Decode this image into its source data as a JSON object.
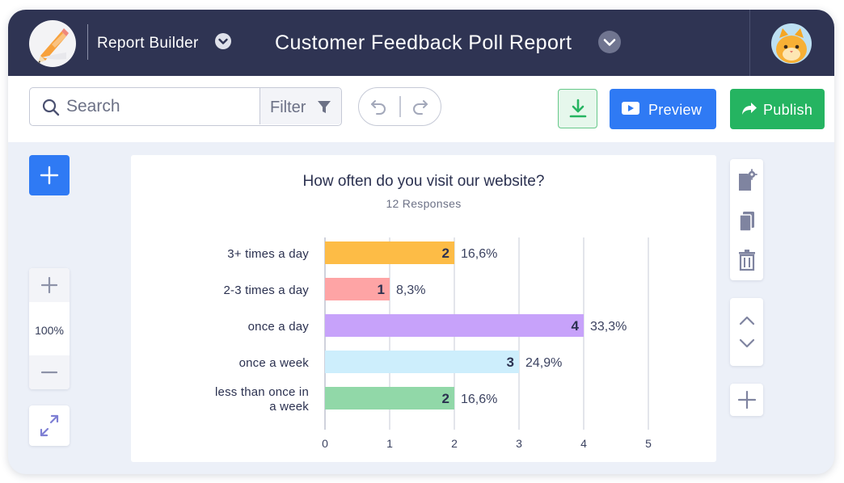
{
  "header": {
    "app_name": "Report Builder",
    "title": "Customer Feedback Poll Report",
    "logo_icon": "pencil-logo-icon",
    "avatar_icon": "cat-avatar-icon"
  },
  "toolbar": {
    "search_placeholder": "Search",
    "filter_label": "Filter",
    "preview_label": "Preview",
    "publish_label": "Publish"
  },
  "zoom": {
    "level": "100%"
  },
  "colors": {
    "header_bg": "#2f3453",
    "preview": "#2f7af4",
    "publish": "#25b461",
    "download_border": "#67c88a"
  },
  "chart_data": {
    "type": "bar",
    "orientation": "horizontal",
    "title": "How often do you visit our website?",
    "subtitle": "12 Responses",
    "categories": [
      "3+ times a day",
      "2-3 times a day",
      "once a day",
      "once a week",
      "less than once in a week"
    ],
    "values": [
      2,
      1,
      4,
      3,
      2
    ],
    "percent_labels": [
      "16,6%",
      "8,3%",
      "33,3%",
      "24,9%",
      "16,6%"
    ],
    "colors": [
      "#fdbc46",
      "#fea4a5",
      "#c7a2fa",
      "#cdeefc",
      "#91d8a8"
    ],
    "xlim": [
      0,
      5
    ],
    "xticks": [
      0,
      1,
      2,
      3,
      4,
      5
    ],
    "grid": true,
    "xlabel": "",
    "ylabel": ""
  }
}
